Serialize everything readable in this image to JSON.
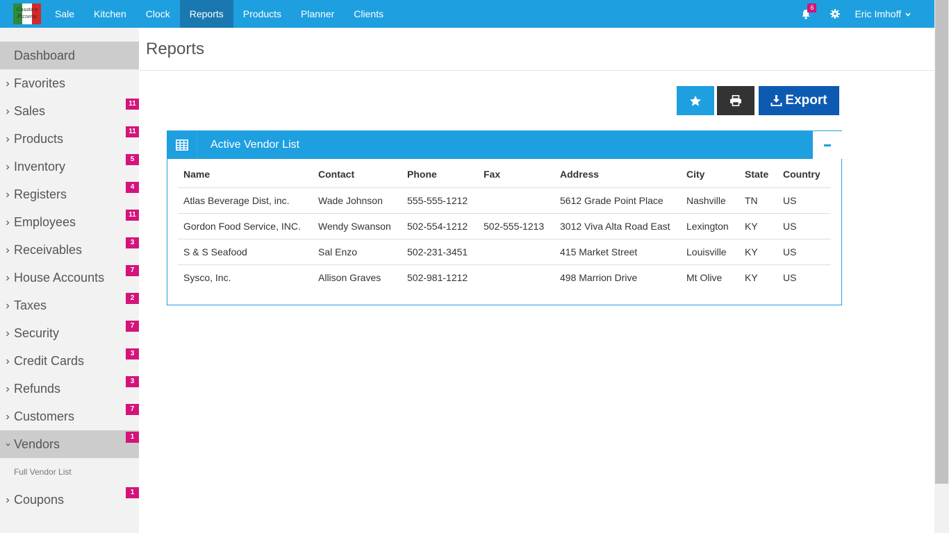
{
  "brand": {
    "logo_text": "Casato's Pizzeria"
  },
  "topnav": {
    "items": [
      {
        "label": "Sale"
      },
      {
        "label": "Kitchen"
      },
      {
        "label": "Clock"
      },
      {
        "label": "Reports",
        "active": true
      },
      {
        "label": "Products"
      },
      {
        "label": "Planner"
      },
      {
        "label": "Clients"
      }
    ],
    "notifications": "6",
    "user": "Eric Imhoff"
  },
  "sidebar": {
    "dashboard": "Dashboard",
    "items": [
      {
        "label": "Favorites",
        "badge": ""
      },
      {
        "label": "Sales",
        "badge": "11"
      },
      {
        "label": "Products",
        "badge": "11"
      },
      {
        "label": "Inventory",
        "badge": "5"
      },
      {
        "label": "Registers",
        "badge": "4"
      },
      {
        "label": "Employees",
        "badge": "11"
      },
      {
        "label": "Receivables",
        "badge": "3"
      },
      {
        "label": "House Accounts",
        "badge": "7"
      },
      {
        "label": "Taxes",
        "badge": "2"
      },
      {
        "label": "Security",
        "badge": "7"
      },
      {
        "label": "Credit Cards",
        "badge": "3"
      },
      {
        "label": "Refunds",
        "badge": "3"
      },
      {
        "label": "Customers",
        "badge": "7"
      },
      {
        "label": "Vendors",
        "badge": "1",
        "open": true
      },
      {
        "label": "Coupons",
        "badge": "1"
      }
    ],
    "vendors_sub": "Full Vendor List"
  },
  "page": {
    "title": "Reports",
    "export_label": "Export"
  },
  "panel": {
    "title": "Active Vendor List",
    "columns": [
      "Name",
      "Contact",
      "Phone",
      "Fax",
      "Address",
      "City",
      "State",
      "Country"
    ],
    "rows": [
      [
        "Atlas Beverage Dist, inc.",
        "Wade Johnson",
        "555-555-1212",
        "",
        "5612 Grade Point Place",
        "Nashville",
        "TN",
        "US"
      ],
      [
        "Gordon Food Service, INC.",
        "Wendy Swanson",
        "502-554-1212",
        "502-555-1213",
        "3012 Viva Alta Road East",
        "Lexington",
        "KY",
        "US"
      ],
      [
        "S & S Seafood",
        "Sal Enzo",
        "502-231-3451",
        "",
        "415 Market Street",
        "Louisville",
        "KY",
        "US"
      ],
      [
        "Sysco, Inc.",
        "Allison Graves",
        "502-981-1212",
        "",
        "498 Marrion Drive",
        "Mt Olive",
        "KY",
        "US"
      ]
    ]
  },
  "colors": {
    "nav_blue": "#1e9fdf",
    "nav_active": "#1a78b0",
    "badge_magenta": "#d4147a",
    "export_blue": "#0d5ab2",
    "print_dark": "#333333"
  },
  "icons": {
    "bell": "bell-icon",
    "gear": "gear-icon",
    "chevron": "chevron-right-icon",
    "star": "star-icon",
    "print": "printer-icon",
    "export": "download-icon",
    "table": "table-icon",
    "collapse": "minus-icon"
  }
}
